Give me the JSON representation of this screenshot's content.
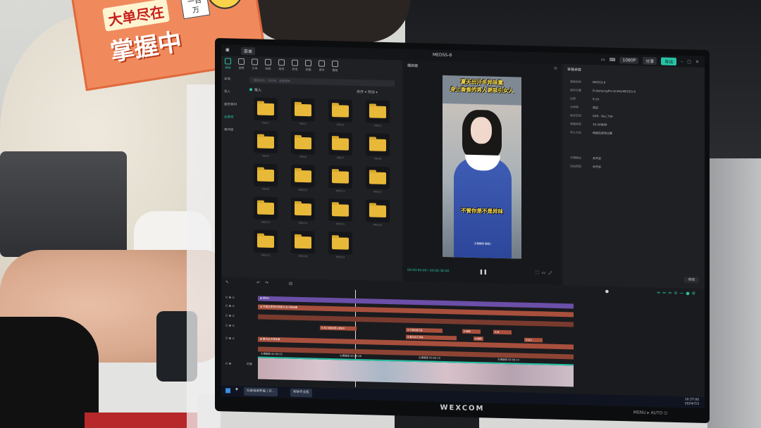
{
  "sign": {
    "line1": "大单尽在",
    "line2": "掌握中",
    "tag": "订单一百万"
  },
  "monitor": {
    "brand": "WEXCOM",
    "buttons": "MENU ▸ AUTO ⏻"
  },
  "app": {
    "menu": "菜单",
    "project_title": "MEDSS-8",
    "resolution_badge": "1080P",
    "share_label": "分享",
    "export_label": "导出",
    "toolbar": [
      {
        "label": "媒体",
        "active": true
      },
      {
        "label": "音频"
      },
      {
        "label": "文本"
      },
      {
        "label": "贴纸"
      },
      {
        "label": "特效"
      },
      {
        "label": "转场"
      },
      {
        "label": "滤镜"
      },
      {
        "label": "调节"
      },
      {
        "label": "模板"
      }
    ],
    "side_nav": [
      "本地",
      "导入",
      "我的素材",
      "云素材",
      "素材库"
    ],
    "search_placeholder": "搜索文件、文件夹、视频素材",
    "import_label": "导入",
    "sort_label": "排序 ▾ 筛选 ▾",
    "folders": [
      "MED1",
      "MED2",
      "MED3",
      "MED4",
      "MED5",
      "MED6",
      "MED7",
      "MED8",
      "MED9",
      "MED10",
      "MED11",
      "MED12",
      "MED13",
      "MED14",
      "MED15",
      "MED16",
      "MED17",
      "MED18",
      "MED19"
    ],
    "player": {
      "title": "播放器",
      "caption_top_1": "夏天出汗冬异味重",
      "caption_top_2": "身上香香的男人更吸引女人",
      "caption_mid": "不管你是不是异味",
      "caption_small": "主播截图 截图1",
      "timecode": "00:00:00:00 / 00:00:36:00"
    },
    "properties": {
      "title": "草稿参数",
      "rows": [
        {
          "k": "草稿名称",
          "v": "MEDSS-8"
        },
        {
          "k": "保存位置",
          "v": "D:/JianyingPro Drafts/MEDSS-8"
        },
        {
          "k": "比例",
          "v": "9:16"
        },
        {
          "k": "分辨率",
          "v": "适应"
        },
        {
          "k": "色彩空间",
          "v": "SDR - Rec.709"
        },
        {
          "k": "草稿帧率",
          "v": "30.00帧/秒"
        },
        {
          "k": "导入方式",
          "v": "保留在原有位置"
        },
        {
          "k": "代理模式",
          "v": "未开启"
        },
        {
          "k": "自由层级",
          "v": "未开启"
        }
      ],
      "modify_button": "修改"
    },
    "timeline": {
      "track1_label": "⊞ 调节2",
      "track2_label": "⊞ 文案这里写的是夏天出汗异味重",
      "track_text_left": "⊞ 夏天出汗异味重",
      "small_clips": [
        "⊞ 身上香香的男人更吸引",
        "⊞ 不管你是不是",
        "⊞ 截图",
        "⊞ 夏天出汗 异味",
        "⊞ 截图",
        "⊞ 香",
        "⊞ 女人"
      ],
      "video_segments": [
        "主播截图 00:00:05",
        "主播截图 00:00:08",
        "主播截图 00:00:10",
        "主播截图 00:00:24"
      ],
      "cover_label": "封面"
    },
    "taskbar": {
      "items": [
        "抖音电商罗盘 | 开...",
        "剪映专业版"
      ],
      "time": "10:37:00",
      "date": "2024/7/3"
    }
  },
  "colors": {
    "accent": "#27c3a6",
    "folder": "#e8b838",
    "track_purple": "#6b4fa8",
    "track_red": "#a8503d"
  }
}
